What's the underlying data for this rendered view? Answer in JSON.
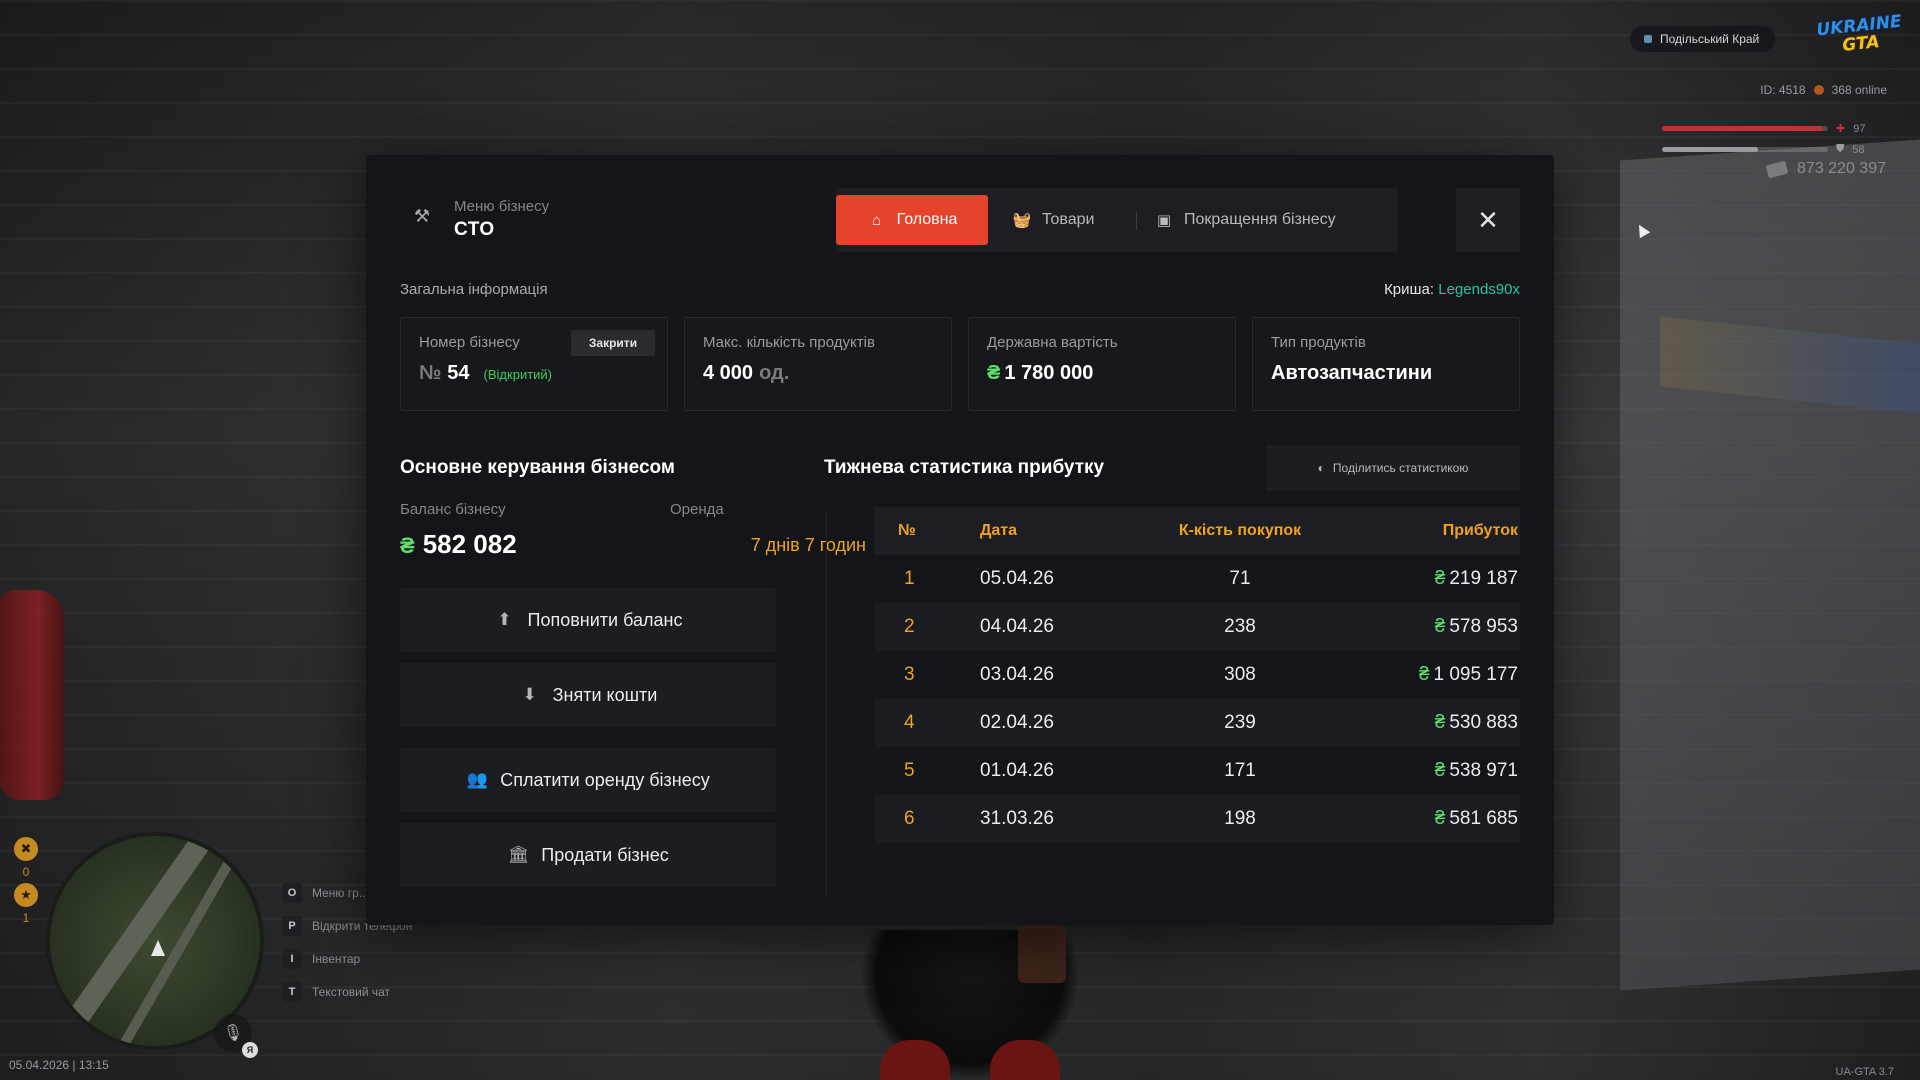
{
  "hud": {
    "server_name": "Подільський Край",
    "logo_line1": "UKRAINE",
    "logo_line2": "GTA",
    "player_id": "ID: 4518",
    "online": "368 online",
    "health": "97",
    "armor": "58",
    "health_pct": 97,
    "armor_pct": 58,
    "money": "873 220 397",
    "wanted_count": "0",
    "stars_count": "1",
    "keys": [
      {
        "key": "O",
        "label": "Меню гр..."
      },
      {
        "key": "P",
        "label": "Відкрити телефон"
      },
      {
        "key": "I",
        "label": "Інвентар"
      },
      {
        "key": "T",
        "label": "Текстовий чат"
      }
    ],
    "mic_badge": "Я",
    "datetime": "05.04.2026 | 13:15",
    "version": "UA-GTA 3.7"
  },
  "modal": {
    "subtitle": "Меню бізнесу",
    "title": "СТО",
    "tabs": [
      {
        "label": "Головна",
        "icon": "home-icon",
        "active": true
      },
      {
        "label": "Товари",
        "icon": "basket-icon",
        "active": false
      },
      {
        "label": "Покращення бізнесу",
        "icon": "upgrade-icon",
        "active": false
      }
    ],
    "close_label": "✕",
    "general": {
      "title": "Загальна інформація",
      "roof_label": "Криша:",
      "roof_value": "Legends90x"
    },
    "cards": {
      "number": {
        "label": "Номер бізнесу",
        "prefix": "№",
        "value": "54",
        "status": "(Відкритий)",
        "button": "Закрити"
      },
      "max_products": {
        "label": "Макс. кількість продуктів",
        "value": "4 000",
        "unit": "од."
      },
      "state_value": {
        "label": "Державна вартість",
        "currency": "₴",
        "value": "1 780 000"
      },
      "product_type": {
        "label": "Тип продуктів",
        "value": "Автозапчастини"
      }
    },
    "control": {
      "title": "Основне керування бізнесом",
      "balance_label": "Баланс бізнесу",
      "balance_currency": "₴",
      "balance_value": "582 082",
      "rent_label": "Оренда",
      "rent_value": "7 днів 7 годин",
      "buttons": [
        {
          "label": "Поповнити баланс",
          "icon": "deposit-icon"
        },
        {
          "label": "Зняти кошти",
          "icon": "withdraw-icon"
        },
        {
          "label": "Сплатити оренду бізнесу",
          "icon": "users-icon"
        },
        {
          "label": "Продати бізнес",
          "icon": "bank-icon"
        }
      ]
    },
    "stats": {
      "title": "Тижнева статистика прибутку",
      "share_label": "Поділитись статистикою",
      "columns": [
        "№",
        "Дата",
        "К-кість покупок",
        "Прибуток"
      ],
      "currency": "₴",
      "rows": [
        {
          "n": "1",
          "date": "05.04.26",
          "count": "71",
          "profit": "219 187"
        },
        {
          "n": "2",
          "date": "04.04.26",
          "count": "238",
          "profit": "578 953"
        },
        {
          "n": "3",
          "date": "03.04.26",
          "count": "308",
          "profit": "1 095 177"
        },
        {
          "n": "4",
          "date": "02.04.26",
          "count": "239",
          "profit": "530 883"
        },
        {
          "n": "5",
          "date": "01.04.26",
          "count": "171",
          "profit": "538 971"
        },
        {
          "n": "6",
          "date": "31.03.26",
          "count": "198",
          "profit": "581 685"
        }
      ]
    }
  },
  "colors": {
    "accent": "#e6432c",
    "orange": "#f0a21e",
    "green": "#5ee06b",
    "teal": "#22c7a0",
    "panel": "#141519"
  }
}
